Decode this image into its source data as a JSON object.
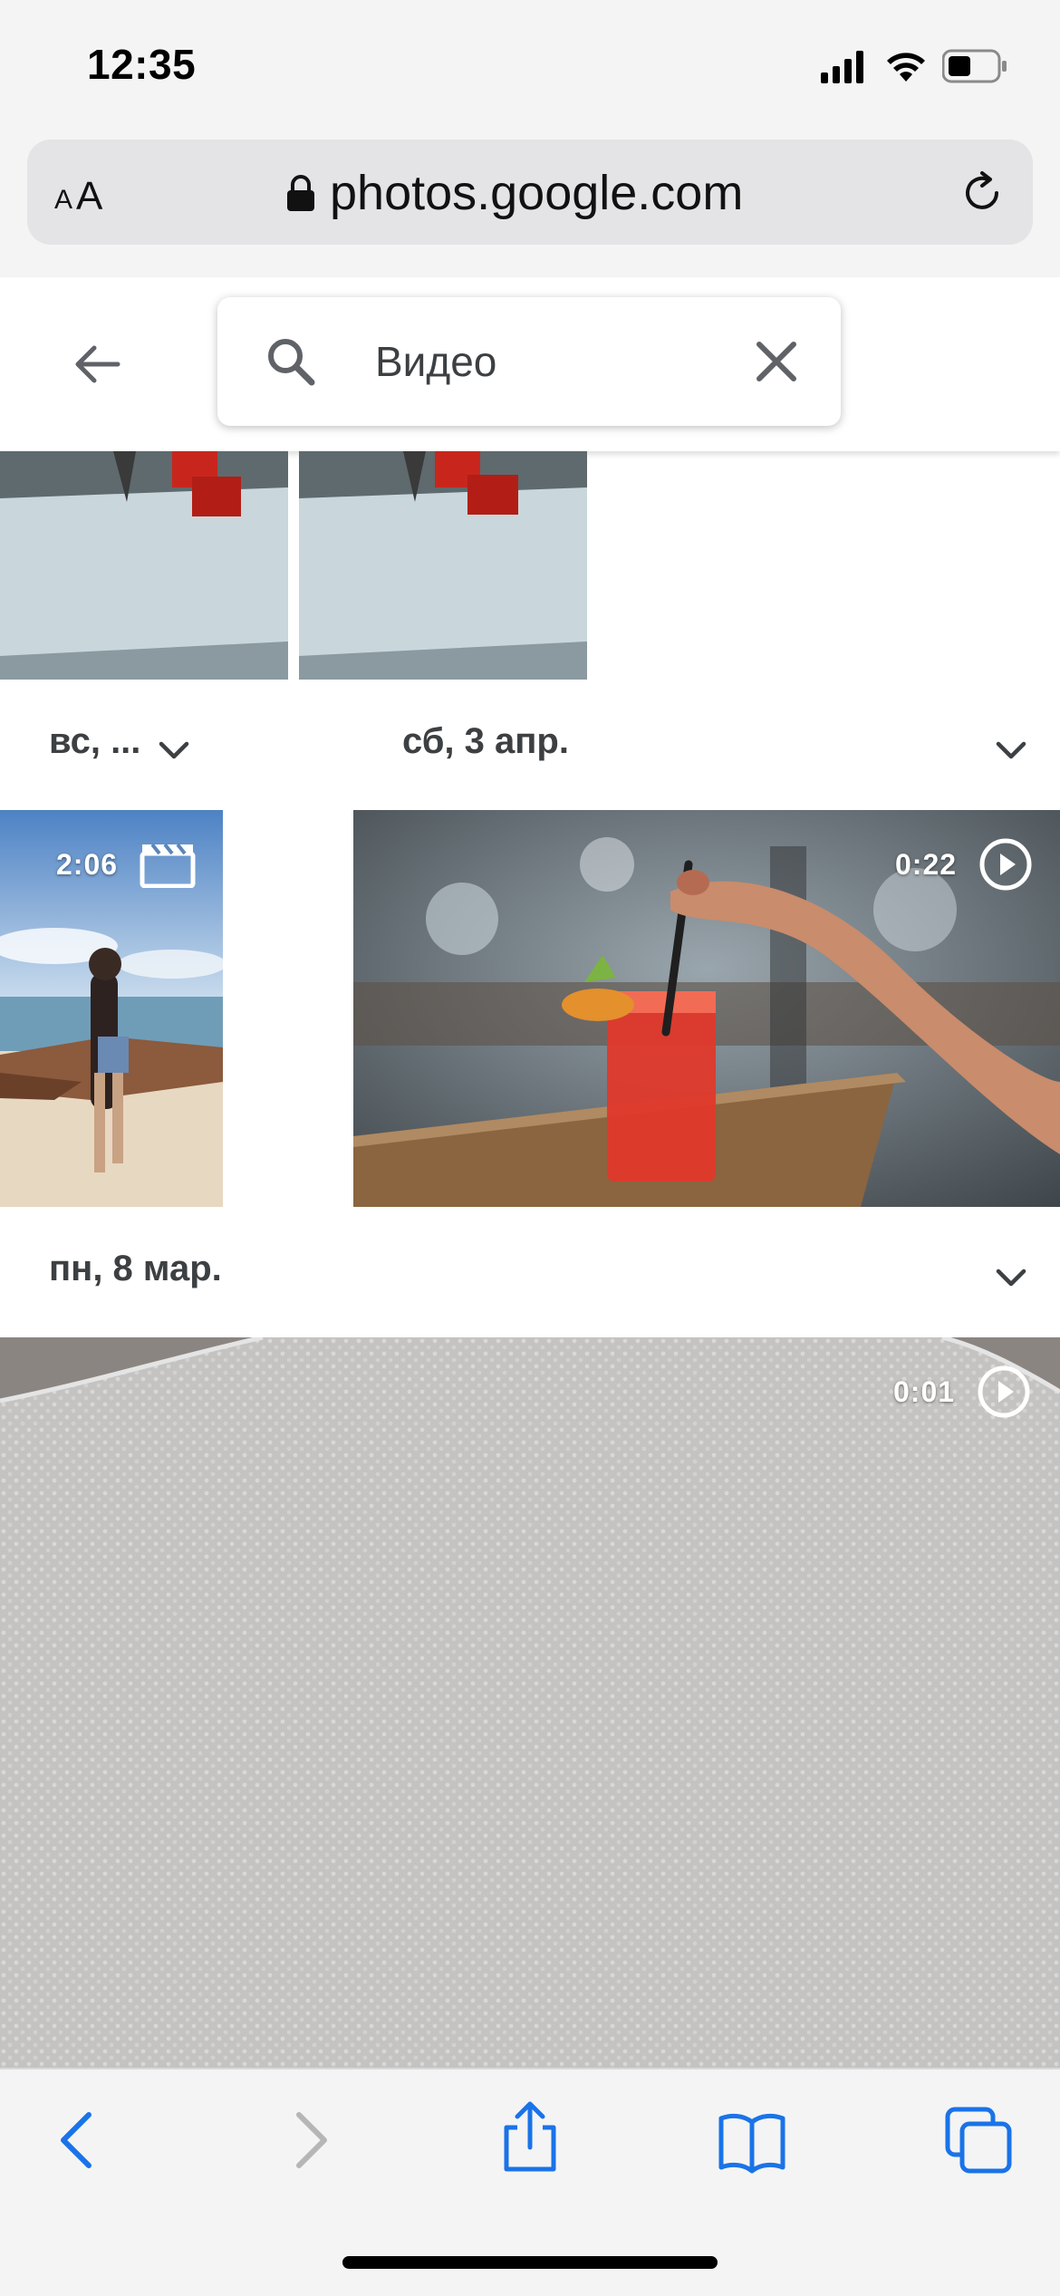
{
  "status_bar": {
    "time": "12:35"
  },
  "browser": {
    "text_size_small": "A",
    "text_size_big": "A",
    "url": "photos.google.com"
  },
  "search": {
    "query": "Видео"
  },
  "groups": [
    {
      "date": "вс, ..."
    },
    {
      "date": "сб, 3 апр."
    },
    {
      "date": "пн, 8 мар."
    }
  ],
  "videos": [
    {
      "duration": "2:06",
      "icon": "movie-clapper-icon"
    },
    {
      "duration": "0:22",
      "icon": "play-circle-icon"
    },
    {
      "duration": "0:01",
      "icon": "play-circle-icon"
    }
  ],
  "colors": {
    "ios_blue": "#1a73e8",
    "chrome_bg": "#f4f4f4",
    "address_bg": "#e4e4e6"
  }
}
